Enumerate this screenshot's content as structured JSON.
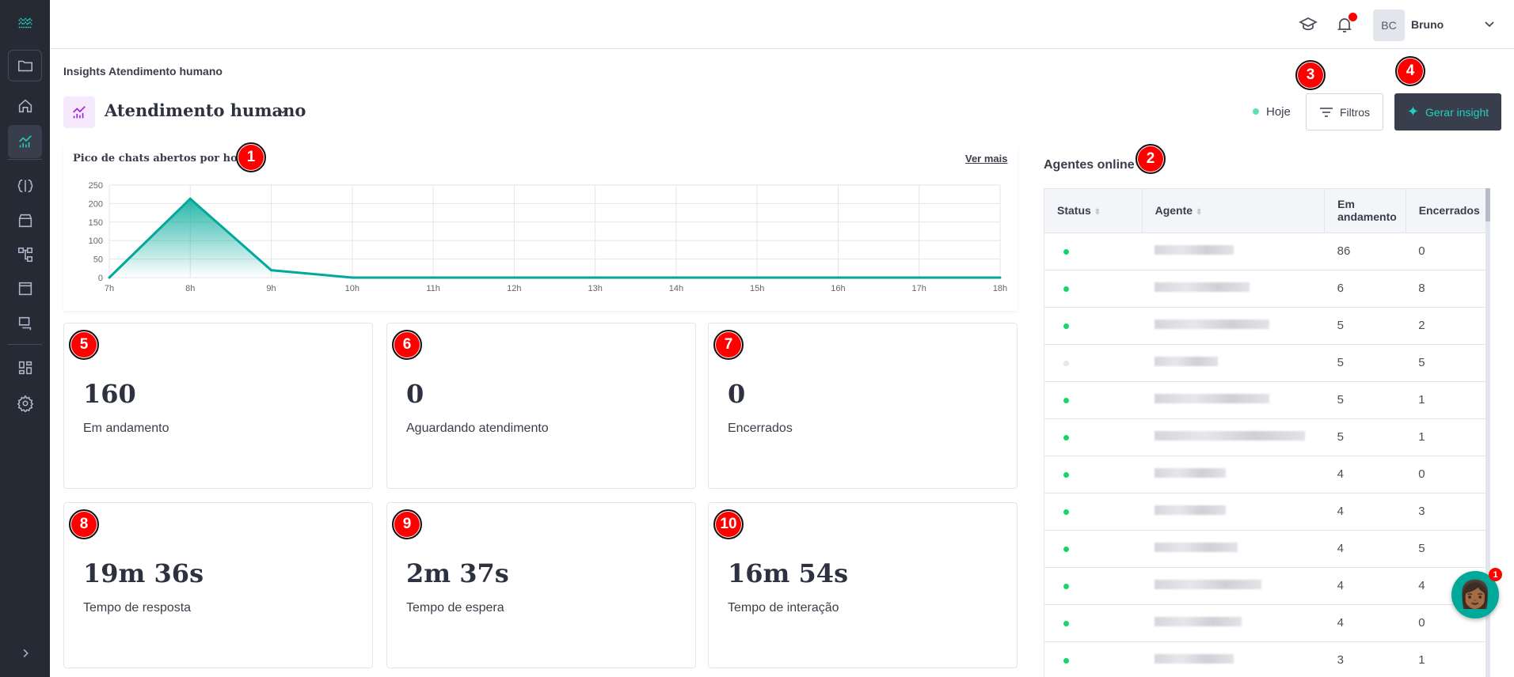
{
  "header": {
    "user_initials": "BC",
    "user_name": "Bruno",
    "notification_dot_color": "#f00000"
  },
  "page": {
    "breadcrumb": "Insights Atendimento humano",
    "title": "Atendimento humano",
    "date_filter": "Hoje",
    "filters_label": "Filtros",
    "generate_label": "Gerar insight",
    "accent": "#00b39e"
  },
  "chart": {
    "title": "Pico de chats abertos por hora",
    "see_more": "Ver mais"
  },
  "chart_data": {
    "type": "area",
    "x": [
      "7h",
      "8h",
      "9h",
      "10h",
      "11h",
      "12h",
      "13h",
      "14h",
      "15h",
      "16h",
      "17h",
      "18h"
    ],
    "values": [
      0,
      213,
      20,
      0,
      0,
      0,
      0,
      0,
      0,
      0,
      0,
      0
    ],
    "yticks": [
      0,
      50,
      100,
      150,
      200,
      250
    ],
    "ylim": [
      0,
      250
    ],
    "grid": true,
    "color": "#00a99a"
  },
  "metrics": [
    {
      "value": "160",
      "label": "Em andamento",
      "badge": "5"
    },
    {
      "value": "0",
      "label": "Aguardando atendimento",
      "badge": "6"
    },
    {
      "value": "0",
      "label": "Encerrados",
      "badge": "7"
    },
    {
      "value": "19m 36s",
      "label": "Tempo de resposta",
      "badge": "8"
    },
    {
      "value": "2m 37s",
      "label": "Tempo de espera",
      "badge": "9"
    },
    {
      "value": "16m 54s",
      "label": "Tempo de interação",
      "badge": "10"
    }
  ],
  "agents": {
    "title": "Agentes online",
    "columns": [
      "Status",
      "Agente",
      "Em andamento",
      "Encerrados"
    ],
    "rows": [
      {
        "online": true,
        "in_progress": "86",
        "closed": "0"
      },
      {
        "online": true,
        "in_progress": "6",
        "closed": "8"
      },
      {
        "online": true,
        "in_progress": "5",
        "closed": "2"
      },
      {
        "online": false,
        "in_progress": "5",
        "closed": "5"
      },
      {
        "online": true,
        "in_progress": "5",
        "closed": "1"
      },
      {
        "online": true,
        "in_progress": "5",
        "closed": "1"
      },
      {
        "online": true,
        "in_progress": "4",
        "closed": "0"
      },
      {
        "online": true,
        "in_progress": "4",
        "closed": "3"
      },
      {
        "online": true,
        "in_progress": "4",
        "closed": "5"
      },
      {
        "online": true,
        "in_progress": "4",
        "closed": "4"
      },
      {
        "online": true,
        "in_progress": "4",
        "closed": "0"
      },
      {
        "online": true,
        "in_progress": "3",
        "closed": "1"
      }
    ]
  },
  "badges": {
    "chart": "1",
    "agents": "2",
    "filters": "3",
    "generate": "4"
  },
  "chat_widget": {
    "unread": "1"
  }
}
